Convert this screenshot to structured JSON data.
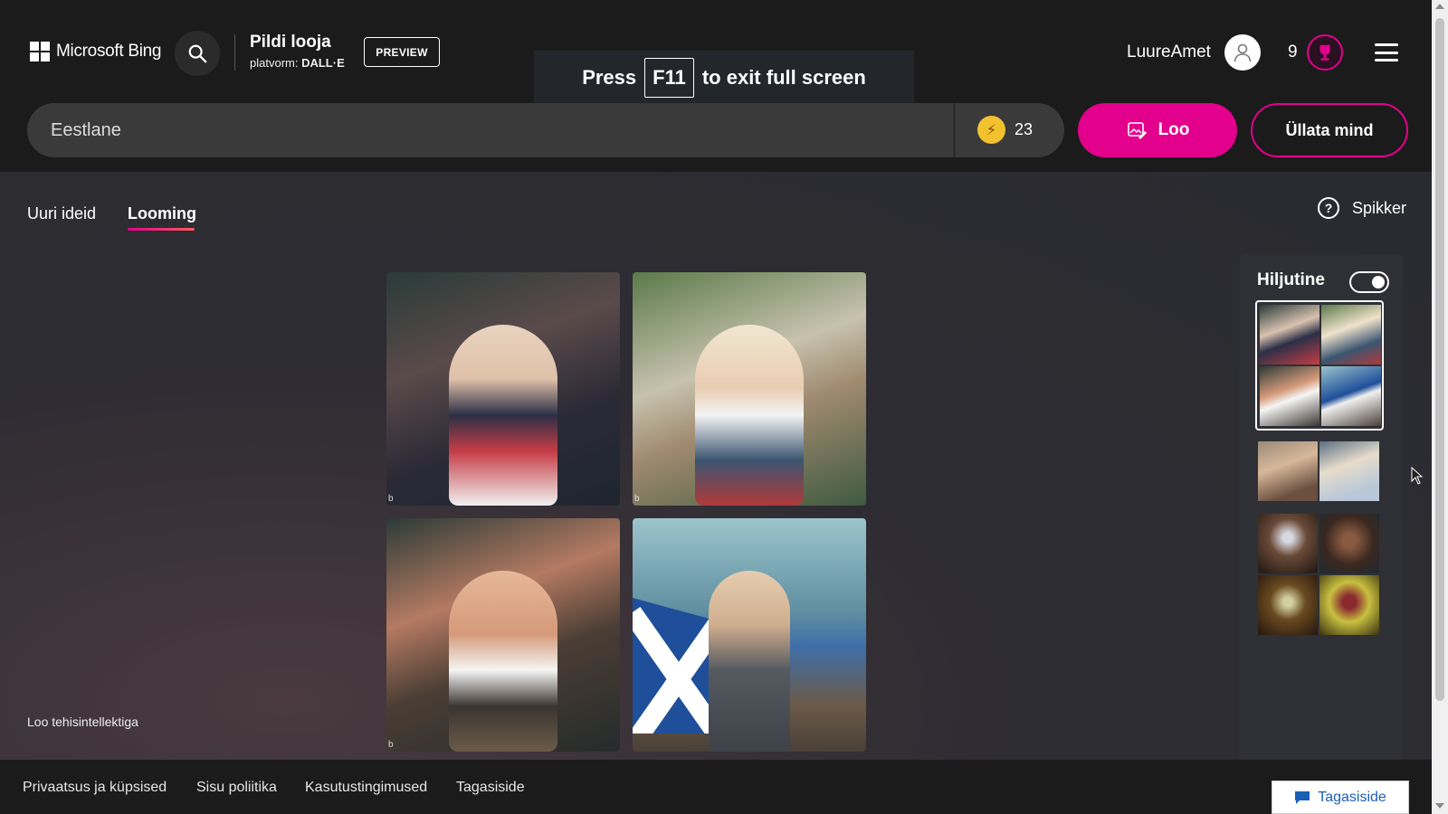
{
  "header": {
    "brand": "Microsoft Bing",
    "app_title": "Pildi looja",
    "platform_label": "platvorm:",
    "platform_name": "DALL·E",
    "preview_badge": "PREVIEW",
    "user_name": "LuureAmet",
    "rewards_count": "9"
  },
  "fullscreen_notice": {
    "prefix": "Press",
    "key": "F11",
    "suffix": "to exit full screen"
  },
  "prompt": {
    "value": "Eestlane",
    "boosts": "23",
    "create_label": "Loo",
    "surprise_label": "Üllata mind"
  },
  "tabs": [
    {
      "label": "Uuri ideid",
      "active": false
    },
    {
      "label": "Looming",
      "active": true
    }
  ],
  "help_label": "Spikker",
  "footer_note": "Loo tehisintellektiga",
  "recent": {
    "title": "Hiljutine",
    "toggle_on": true
  },
  "footer": {
    "links": [
      "Privaatsus ja küpsised",
      "Sisu poliitika",
      "Kasutustingimused",
      "Tagasiside"
    ],
    "feedback_button": "Tagasiside"
  },
  "colors": {
    "accent": "#e3008c",
    "background": "#1b1b1b",
    "boost": "#f2c12e"
  },
  "icons": [
    "microsoft-logo-icon",
    "search-icon",
    "user-icon",
    "trophy-icon",
    "hamburger-menu-icon",
    "boost-bolt-icon",
    "create-image-icon",
    "help-icon",
    "feedback-chat-icon"
  ]
}
